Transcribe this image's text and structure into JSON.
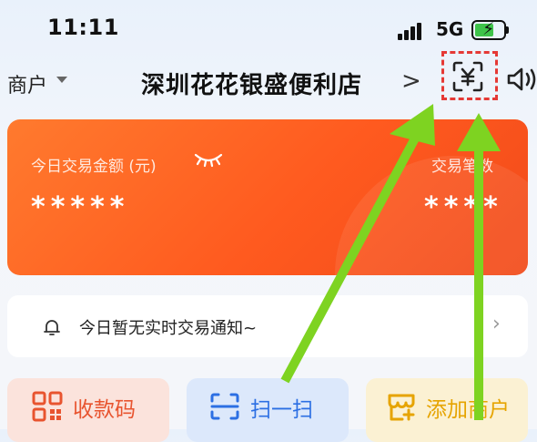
{
  "status_bar": {
    "time": "11:11",
    "network": "5G",
    "icons": [
      "signal-icon",
      "battery-charging-icon"
    ]
  },
  "header": {
    "merchant_switch": "商户",
    "store_name": "深圳花花银盛便利店",
    "chevron": ">",
    "icons": [
      "scan-pay-icon",
      "speaker-icon"
    ]
  },
  "summary": {
    "amount_label": "今日交易金额 (元)",
    "amount_value": "*****",
    "count_label": "交易笔数",
    "count_value": "****",
    "icons": [
      "eye-closed-icon"
    ]
  },
  "notice": {
    "text": "今日暂无实时交易通知~",
    "icons": [
      "bell-icon",
      "chevron-right-icon"
    ]
  },
  "actions": [
    {
      "label": "收款码",
      "icon": "qr-code-icon",
      "color": "#e8542f"
    },
    {
      "label": "扫一扫",
      "icon": "scan-icon",
      "color": "#2c6fe3"
    },
    {
      "label": "添加商户",
      "icon": "add-merchant-icon",
      "color": "#e6a400"
    }
  ],
  "colors": {
    "card_gradient_start": "#ff7a2e",
    "card_gradient_end": "#f14a1a",
    "highlight": "#e53935",
    "annotation_arrow": "#7ed321"
  }
}
